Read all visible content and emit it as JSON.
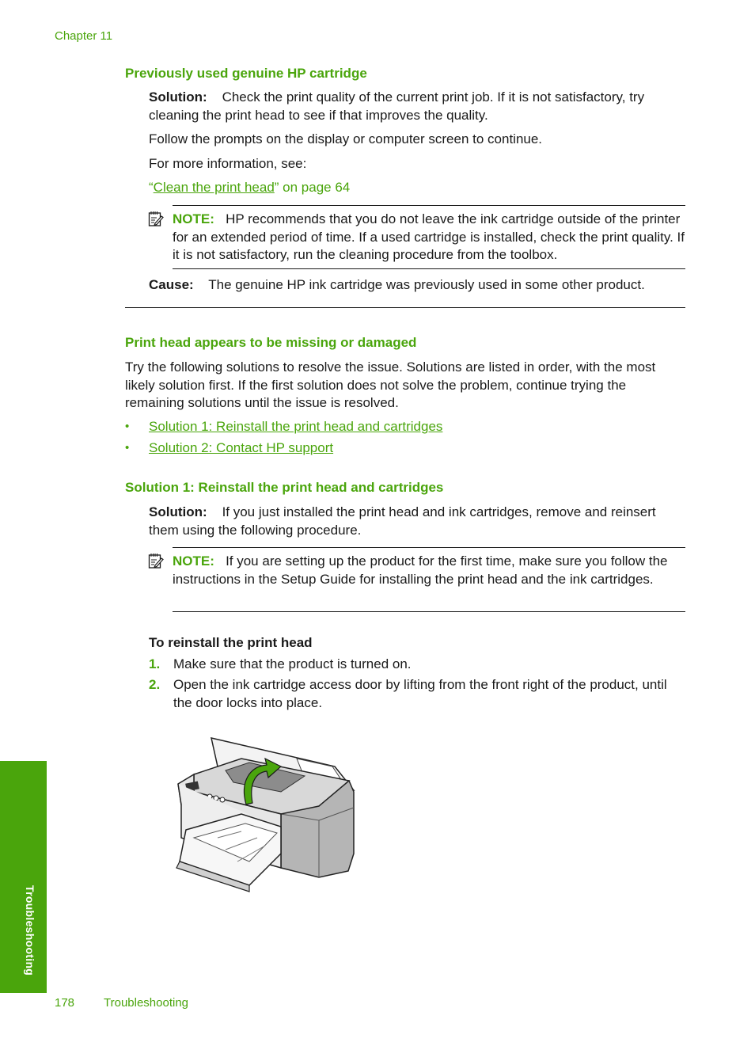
{
  "header": {
    "chapter": "Chapter 11"
  },
  "section1": {
    "title": "Previously used genuine HP cartridge",
    "solution_label": "Solution:",
    "solution_text": "Check the print quality of the current print job. If it is not satisfactory, try cleaning the print head to see if that improves the quality.",
    "follow": "Follow the prompts on the display or computer screen to continue.",
    "more_info": "For more information, see:",
    "link_open_quote": "“",
    "link_text": "Clean the print head",
    "link_suffix": "” on page 64",
    "note_label": "NOTE:",
    "note_text": "HP recommends that you do not leave the ink cartridge outside of the printer for an extended period of time. If a used cartridge is installed, check the print quality. If it is not satisfactory, run the cleaning procedure from the toolbox.",
    "cause_label": "Cause:",
    "cause_text": "The genuine HP ink cartridge was previously used in some other product."
  },
  "section2": {
    "title": "Print head appears to be missing or damaged",
    "intro": "Try the following solutions to resolve the issue. Solutions are listed in order, with the most likely solution first. If the first solution does not solve the problem, continue trying the remaining solutions until the issue is resolved.",
    "bullet_glyph": "•",
    "links": [
      "Solution 1: Reinstall the print head and cartridges",
      "Solution 2: Contact HP support"
    ]
  },
  "section3": {
    "title": "Solution 1: Reinstall the print head and cartridges",
    "solution_label": "Solution:",
    "solution_text": "If you just installed the print head and ink cartridges, remove and reinsert them using the following procedure.",
    "note_label": "NOTE:",
    "note_text": "If you are setting up the product for the first time, make sure you follow the instructions in the Setup Guide for installing the print head and the ink cartridges.",
    "procedure_title": "To reinstall the print head",
    "steps": [
      {
        "num": "1.",
        "text": "Make sure that the product is turned on."
      },
      {
        "num": "2.",
        "text": "Open the ink cartridge access door by lifting from the front right of the product, until the door locks into place."
      }
    ]
  },
  "figure": {
    "alt": "printer-open-access-door-illustration"
  },
  "sidebar": {
    "label": "Troubleshooting"
  },
  "footer": {
    "page_number": "178",
    "section": "Troubleshooting"
  },
  "colors": {
    "accent": "#4aa50c",
    "text": "#1a1a1a"
  }
}
